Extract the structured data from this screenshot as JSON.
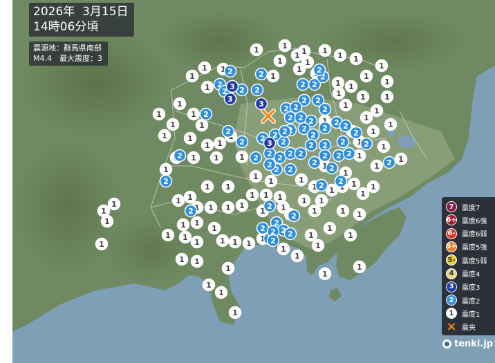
{
  "header": {
    "date": "2026年  3月15日",
    "time": "14時06分頃"
  },
  "details": {
    "epicenter": "震源地：群馬県南部",
    "magnitude_line": "M4.4　最大震度：3"
  },
  "legend": [
    {
      "icon": "7",
      "label": "震度7",
      "color": "#8b1a4a"
    },
    {
      "icon": "6+",
      "label": "震度6強",
      "color": "#a8122a"
    },
    {
      "icon": "6-",
      "label": "震度6弱",
      "color": "#d83a2a"
    },
    {
      "icon": "5+",
      "label": "震度5強",
      "color": "#e0842a"
    },
    {
      "icon": "5-",
      "label": "震度5弱",
      "color": "#e6cc33"
    },
    {
      "icon": "4",
      "label": "震度4",
      "color": "#ead88a"
    },
    {
      "icon": "3",
      "label": "震度3",
      "color": "#1f3aa8"
    },
    {
      "icon": "2",
      "label": "震度2",
      "color": "#2f8fdc"
    },
    {
      "icon": "1",
      "label": "震度1",
      "color": "#ffffff"
    },
    {
      "icon": "×",
      "label": "震央",
      "color": "#f08a1c"
    }
  ],
  "brand": "tenki.jp",
  "colors": {
    "sea": "#7f9fb6",
    "land": "#6f8a62",
    "mountain": "#5d7452",
    "plain": "#9aae8a",
    "int3": "#1f3aa8",
    "int2": "#2f8fdc",
    "int1": "#ffffff",
    "epicenter": "#f08a1c"
  }
}
